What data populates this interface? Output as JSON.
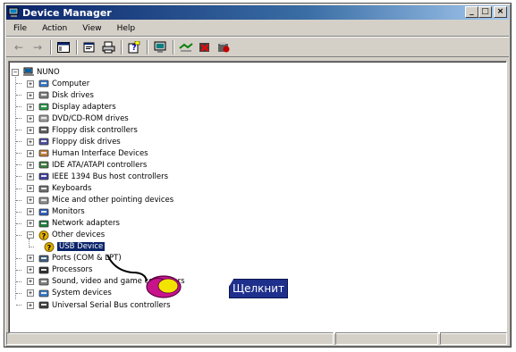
{
  "window": {
    "title": "Device Manager",
    "controls": {
      "minimize": "_",
      "maximize": "□",
      "close": "×"
    }
  },
  "menu": [
    "File",
    "Action",
    "View",
    "Help"
  ],
  "toolbar": {
    "icons": [
      "back-arrow-icon",
      "forward-arrow-icon",
      "show-hide-console-tree-icon",
      "properties-icon",
      "print-icon",
      "help-icon",
      "scan-hardware-icon",
      "update-driver-icon",
      "uninstall-icon",
      "disable-icon"
    ]
  },
  "tree": {
    "root": "NUNO",
    "items": [
      {
        "label": "Computer",
        "icon": "computer-icon",
        "state": "collapsed"
      },
      {
        "label": "Disk drives",
        "icon": "disk-drive-icon",
        "state": "collapsed"
      },
      {
        "label": "Display adapters",
        "icon": "display-adapter-icon",
        "state": "collapsed"
      },
      {
        "label": "DVD/CD-ROM drives",
        "icon": "cdrom-icon",
        "state": "collapsed"
      },
      {
        "label": "Floppy disk controllers",
        "icon": "floppy-controller-icon",
        "state": "collapsed"
      },
      {
        "label": "Floppy disk drives",
        "icon": "floppy-drive-icon",
        "state": "collapsed"
      },
      {
        "label": "Human Interface Devices",
        "icon": "hid-icon",
        "state": "collapsed"
      },
      {
        "label": "IDE ATA/ATAPI controllers",
        "icon": "ide-controller-icon",
        "state": "collapsed"
      },
      {
        "label": "IEEE 1394 Bus host controllers",
        "icon": "firewire-icon",
        "state": "collapsed"
      },
      {
        "label": "Keyboards",
        "icon": "keyboard-icon",
        "state": "collapsed"
      },
      {
        "label": "Mice and other pointing devices",
        "icon": "mouse-icon",
        "state": "collapsed"
      },
      {
        "label": "Monitors",
        "icon": "monitor-icon",
        "state": "collapsed"
      },
      {
        "label": "Network adapters",
        "icon": "network-adapter-icon",
        "state": "collapsed"
      },
      {
        "label": "Other devices",
        "icon": "other-devices-icon",
        "state": "expanded"
      },
      {
        "label": "USB Device",
        "icon": "unknown-device-icon",
        "state": "child",
        "selected": true
      },
      {
        "label": "Ports (COM & LPT)",
        "icon": "port-icon",
        "state": "collapsed"
      },
      {
        "label": "Processors",
        "icon": "processor-icon",
        "state": "collapsed"
      },
      {
        "label": "Sound, video and game controllers",
        "icon": "sound-icon",
        "state": "collapsed"
      },
      {
        "label": "System devices",
        "icon": "system-icon",
        "state": "collapsed"
      },
      {
        "label": "Universal Serial Bus controllers",
        "icon": "usb-icon",
        "state": "collapsed"
      }
    ]
  },
  "annotation": {
    "callout_text": "Щелкнит",
    "pointer_icon": "mouse-pointer-icon"
  },
  "colors": {
    "titlebar_start": "#0a246a",
    "titlebar_end": "#a6caf0",
    "window_face": "#d4d0c8",
    "selection": "#0a246a",
    "callout_bg": "#1e2f8c",
    "mouse_yellow": "#f2e400",
    "mouse_magenta": "#c8148c"
  }
}
